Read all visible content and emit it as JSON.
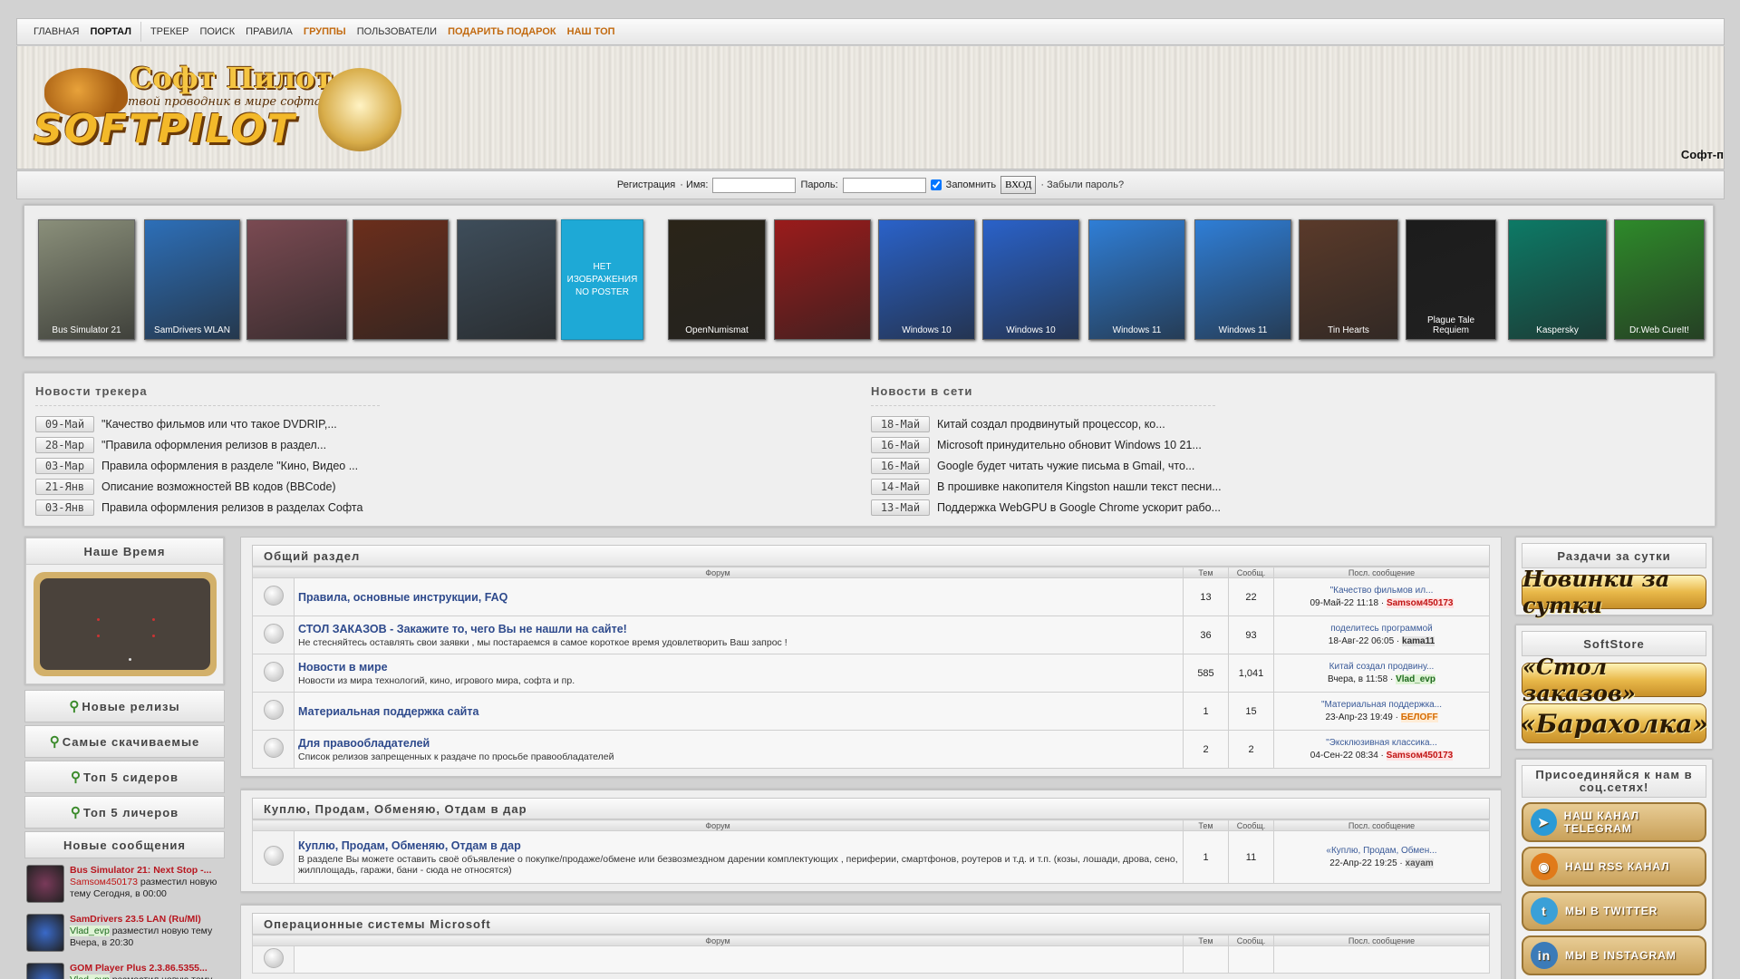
{
  "nav": {
    "items": [
      {
        "label": "ГЛАВНАЯ",
        "style": "normal"
      },
      {
        "label": "ПОРТАЛ",
        "style": "bold"
      },
      {
        "label": "ТРЕКЕР",
        "style": "normal"
      },
      {
        "label": "ПОИСК",
        "style": "normal"
      },
      {
        "label": "ПРАВИЛА",
        "style": "normal"
      },
      {
        "label": "ГРУППЫ",
        "style": "orange"
      },
      {
        "label": "ПОЛЬЗОВАТЕЛИ",
        "style": "normal"
      },
      {
        "label": "ПОДАРИТЬ ПОДАРОК",
        "style": "orange"
      },
      {
        "label": "НАШ ТОП",
        "style": "orange"
      }
    ]
  },
  "header": {
    "logo_title": "Софт Пилот",
    "logo_tagline": "твой проводник в мире софта",
    "logo_wordmark": "SOFTPILOT",
    "ticker": "⁠ Софт-п"
  },
  "login": {
    "register_label": "Регистрация",
    "name_label": "· Имя:",
    "name_value": "",
    "password_label": "Пароль:",
    "password_value": "",
    "remember_label": "Запомнить",
    "remember_checked": true,
    "submit_label": "ВХОД",
    "forgot_label": "· Забыли пароль?"
  },
  "covers": [
    {
      "caption": "Bus Simulator 21",
      "color": "#8a8f7a"
    },
    {
      "caption": "SamDrivers WLAN",
      "color": "#2d6fb8"
    },
    {
      "caption": "",
      "color": "#7a4a52"
    },
    {
      "caption": "",
      "color": "#6b2e1c"
    },
    {
      "caption": "",
      "color": "#3e4d5a"
    },
    {
      "caption": "НЕТ ИЗОБРАЖЕНИЯ NO POSTER",
      "color": "#1ea9d6",
      "noposter": true
    },
    {
      "caption": "OpenNumismat",
      "color": "#2a2418"
    },
    {
      "caption": "",
      "color": "#9a1b1b"
    },
    {
      "caption": "Windows 10",
      "color": "#2a62c9"
    },
    {
      "caption": "Windows 10",
      "color": "#2a62c9"
    },
    {
      "caption": "Windows 11",
      "color": "#2f7ed6"
    },
    {
      "caption": "Windows 11",
      "color": "#2f7ed6"
    },
    {
      "caption": "Tin Hearts",
      "color": "#5a3a2a"
    },
    {
      "caption": "Plague Tale Requiem",
      "color": "#1c1c1c"
    },
    {
      "caption": "Kaspersky",
      "color": "#0d7a66"
    },
    {
      "caption": "Dr.Web CureIt!",
      "color": "#2e8a2a"
    }
  ],
  "tracker_news": {
    "title": "Новости трекера",
    "items": [
      {
        "date": "09-Май",
        "text": "\"Качество фильмов или что такое DVDRIP,..."
      },
      {
        "date": "28-Мар",
        "text": "\"Правила оформления релизов в раздел..."
      },
      {
        "date": "03-Мар",
        "text": "Правила оформления в разделе \"Кино, Видео ..."
      },
      {
        "date": "21-Янв",
        "text": "Описание возможностей ВВ кодов (BBCode)"
      },
      {
        "date": "03-Янв",
        "text": "Правила оформления релизов в разделах Софта"
      }
    ]
  },
  "net_news": {
    "title": "Новости в сети",
    "items": [
      {
        "date": "18-Май",
        "text": "Китай создал продвинутый процессор, ко..."
      },
      {
        "date": "16-Май",
        "text": "Microsoft принудительно обновит Windows 10 21..."
      },
      {
        "date": "16-Май",
        "text": "Google будет читать чужие письма в Gmail, что..."
      },
      {
        "date": "14-Май",
        "text": "В прошивке накопителя Kingston нашли текст песни..."
      },
      {
        "date": "13-Май",
        "text": "Поддержка WebGPU в Google Chrome ускорит рабо..."
      }
    ]
  },
  "left": {
    "clock_title": "Наше Время",
    "buttons": [
      "Новые релизы",
      "Самые скачиваемые",
      "Топ 5 сидеров",
      "Топ 5 личеров"
    ],
    "new_messages_title": "Новые сообщения",
    "messages": [
      {
        "title": "Bus Simulator 21: Next Stop -...",
        "user": "Samsoм450173",
        "user_style": "red",
        "rest": " разместил новую тему Сегодня, в 00:00",
        "avatar": "#7a3a5a"
      },
      {
        "title": "SamDrivers 23.5 LAN (Ru/Ml)",
        "user": "Vlad_evp",
        "user_style": "green",
        "rest": " разместил новую тему Вчера, в 20:30",
        "avatar": "#3a6ac9"
      },
      {
        "title": "GOM Player Plus 2.3.86.5355...",
        "user": "Vlad_evp",
        "user_style": "green",
        "rest": " разместил новую тему",
        "avatar": "#3a6ac9"
      }
    ]
  },
  "forum_headers": {
    "forum": "Форум",
    "topics": "Тем",
    "posts": "Сообщ.",
    "last": "Посл. сообщение"
  },
  "sections": [
    {
      "title": "Общий раздел",
      "forums": [
        {
          "name": "Правила, основные инструкции, FAQ",
          "desc": "",
          "topics": "13",
          "posts": "22",
          "last_title": "\"Качество фильмов ил...",
          "last_date": "09-Май-22 11:18",
          "last_user": "Samsoм450173",
          "last_user_style": "red",
          "locked": false
        },
        {
          "name": "СТОЛ ЗАКАЗОВ - Закажите то, чего Вы не нашли на сайте!",
          "desc": "Не стесняйтесь оставлять свои заявки , мы постараемся в самое короткое время удовлетворить Ваш запрос !",
          "topics": "36",
          "posts": "93",
          "last_title": "поделитесь программой",
          "last_date": "18-Авг-22 06:05",
          "last_user": "kama11",
          "last_user_style": "gray",
          "locked": true
        },
        {
          "name": "Новости в мире",
          "desc": "Новости из мира технологий, кино, игрового мира, софта и пр.",
          "topics": "585",
          "posts": "1,041",
          "last_title": "Китай создал продвину...",
          "last_date": "Вчера, в 11:58",
          "last_user": "Vlad_evp",
          "last_user_style": "green",
          "locked": false
        },
        {
          "name": "Материальная поддержка сайта",
          "desc": "",
          "topics": "1",
          "posts": "15",
          "last_title": "\"Материальная поддержка...",
          "last_date": "23-Апр-23 19:49",
          "last_user": "БЕЛОFF",
          "last_user_style": "orange",
          "locked": false
        },
        {
          "name": "Для правообладателей",
          "desc": "Список релизов запрещенных к раздаче по просьбе правообладателей",
          "topics": "2",
          "posts": "2",
          "last_title": "\"Эксклюзивная классика...",
          "last_date": "04-Сен-22 08:34",
          "last_user": "Samsoм450173",
          "last_user_style": "red",
          "locked": false
        }
      ]
    },
    {
      "title": "Куплю, Продам, Обменяю, Отдам в дар",
      "forums": [
        {
          "name": "Куплю, Продам, Обменяю, Отдам в дар",
          "desc": "В разделе Вы можете оставить своё объявление о покупке/продаже/обмене или безвозмездном дарении комплектующих , периферии, смартфонов, роутеров и т.д. и т.п. (козы, лошади, дрова, сено, жилплощадь, гаражи, бани - сюда не относятся)",
          "topics": "1",
          "posts": "11",
          "last_title": "«Куплю, Продам, Обмен...",
          "last_date": "22-Апр-22 19:25",
          "last_user": "xayam",
          "last_user_style": "xgray",
          "locked": false
        }
      ]
    },
    {
      "title": "Операционные системы Microsoft",
      "forums": []
    }
  ],
  "right": {
    "daily_title": "Раздачи за сутки",
    "daily_banner": "Новинки за сутки",
    "store_title": "SoftStore",
    "store_banners": [
      "«Стол заказов»",
      "«Барахолка»"
    ],
    "social_title": "Присоединяйся к нам в соц.сетях!",
    "social": [
      {
        "label": "НАШ КАНАЛ TELEGRAM",
        "icon": "telegram-icon",
        "color": "#2a9ad6",
        "glyph": "➤"
      },
      {
        "label": "НАШ RSS  КАНАЛ",
        "icon": "rss-icon",
        "color": "#e07a1a",
        "glyph": "◉"
      },
      {
        "label": "МЫ В TWITTER",
        "icon": "twitter-icon",
        "color": "#3aa0d8",
        "glyph": "t"
      },
      {
        "label": "МЫ В INSTAGRAM",
        "icon": "instagram-icon",
        "color": "#3b7bb8",
        "glyph": "in"
      }
    ]
  }
}
